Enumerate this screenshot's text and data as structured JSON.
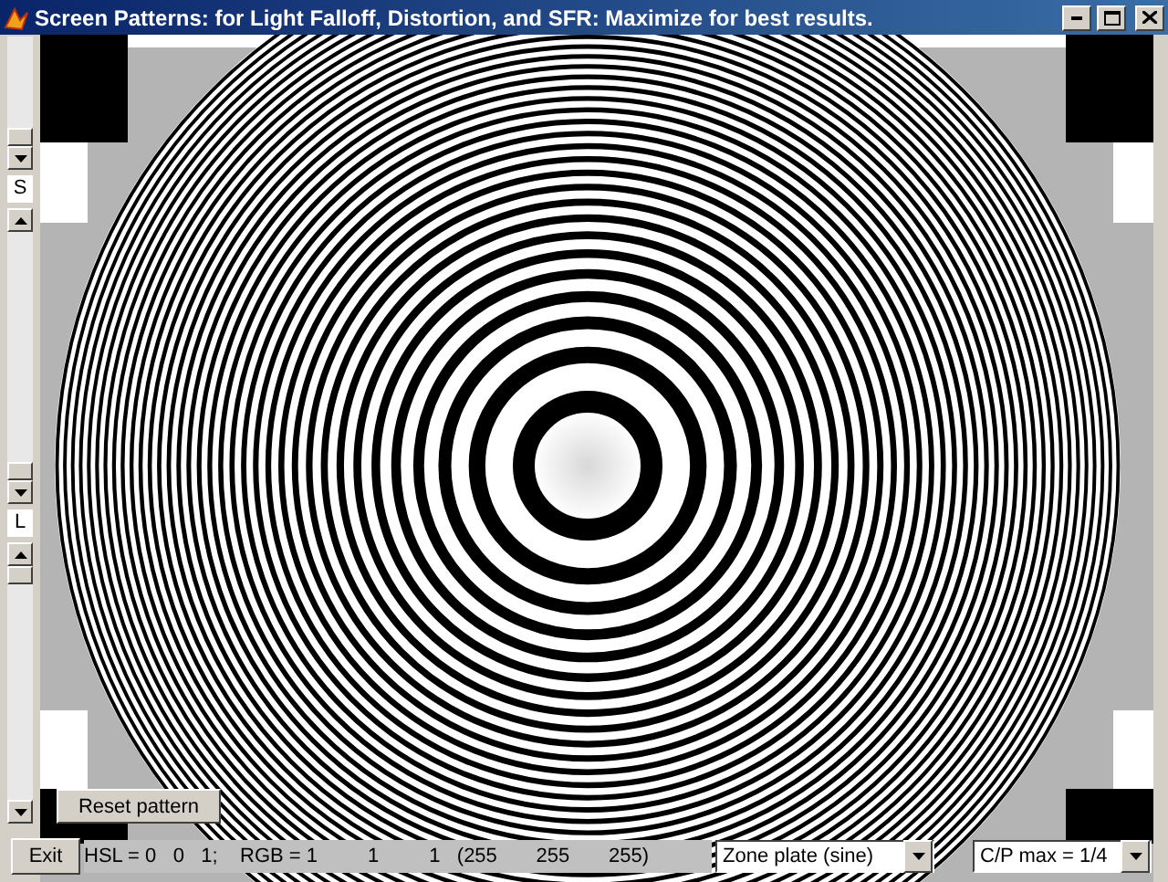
{
  "window": {
    "title": "Screen Patterns:  for Light Falloff, Distortion, and SFR:   Maximize for best results."
  },
  "slider_labels": [
    "S",
    "L"
  ],
  "reset_button": "Reset pattern",
  "exit_button": "Exit",
  "status": "HSL = 0   0   1;    RGB = 1         1         1   (255       255       255)",
  "dropdowns": [
    {
      "value": "Zone plate (sine)"
    },
    {
      "value": "C/P max = 1/4"
    }
  ]
}
